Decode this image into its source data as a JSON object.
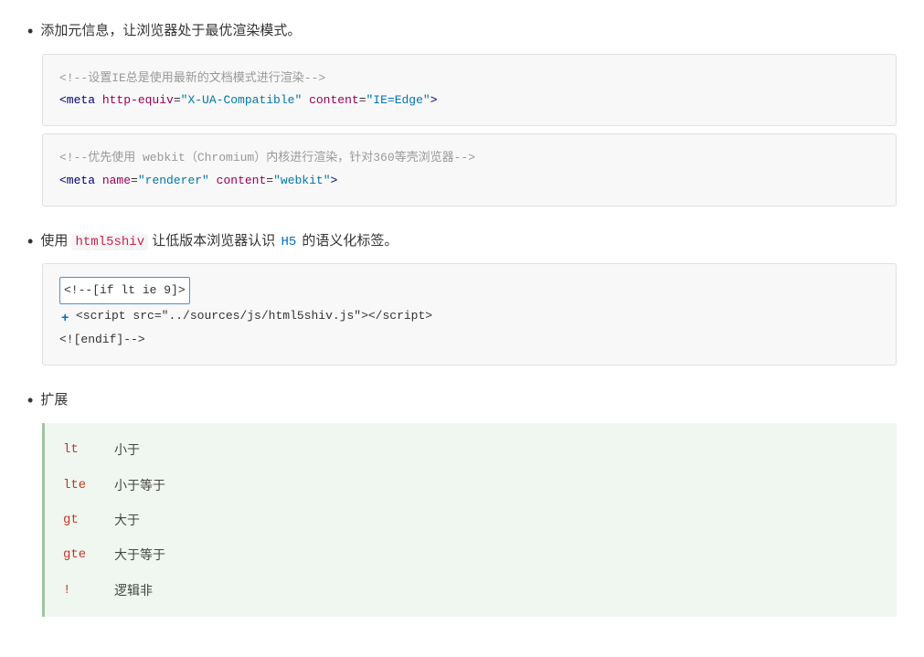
{
  "sections": [
    {
      "id": "meta-section",
      "bullet": "•",
      "intro_text": "添加元信息，让浏览器处于最优渲染模式。",
      "codeblocks": [
        {
          "lines": [
            {
              "type": "comment",
              "text": "<!--设置IE总是使用最新的文档模式进行渲染-->"
            },
            {
              "type": "tag-line",
              "text": "<meta http-equiv=\"X-UA-Compatible\" content=\"IE=Edge\">"
            }
          ]
        },
        {
          "lines": [
            {
              "type": "comment",
              "text": "<!--优先使用 webkit（Chromium）内核进行渲染，针对360等壳浏览器-->"
            },
            {
              "type": "tag-line",
              "text": "<meta name=\"renderer\" content=\"webkit\">"
            }
          ]
        }
      ]
    },
    {
      "id": "html5shiv-section",
      "bullet": "•",
      "intro_parts": [
        {
          "type": "text",
          "value": "使用 "
        },
        {
          "type": "code",
          "value": "html5shiv"
        },
        {
          "type": "text",
          "value": " 让低版本浏览器认识 "
        },
        {
          "type": "code-blue",
          "value": "H5"
        },
        {
          "type": "text",
          "value": " 的语义化标签。"
        }
      ],
      "if_block": {
        "highlighted_line": "<!--[if lt ie 9]>",
        "lines": [
          {
            "type": "indent-tag",
            "text": "<script src=\"../sources/js/html5shiv.js\"></script>"
          },
          {
            "type": "normal",
            "text": "<![endif]-->"
          }
        ]
      }
    },
    {
      "id": "expand-section",
      "bullet": "•",
      "intro_text": "扩展",
      "expansion_items": [
        {
          "key": "lt",
          "desc": "小于"
        },
        {
          "key": "lte",
          "desc": "小于等于"
        },
        {
          "key": "gt",
          "desc": "大于"
        },
        {
          "key": "gte",
          "desc": "大于等于"
        },
        {
          "key": "!",
          "desc": "逻辑非"
        }
      ]
    }
  ],
  "icons": {
    "bullet": "•",
    "plus": "+"
  }
}
